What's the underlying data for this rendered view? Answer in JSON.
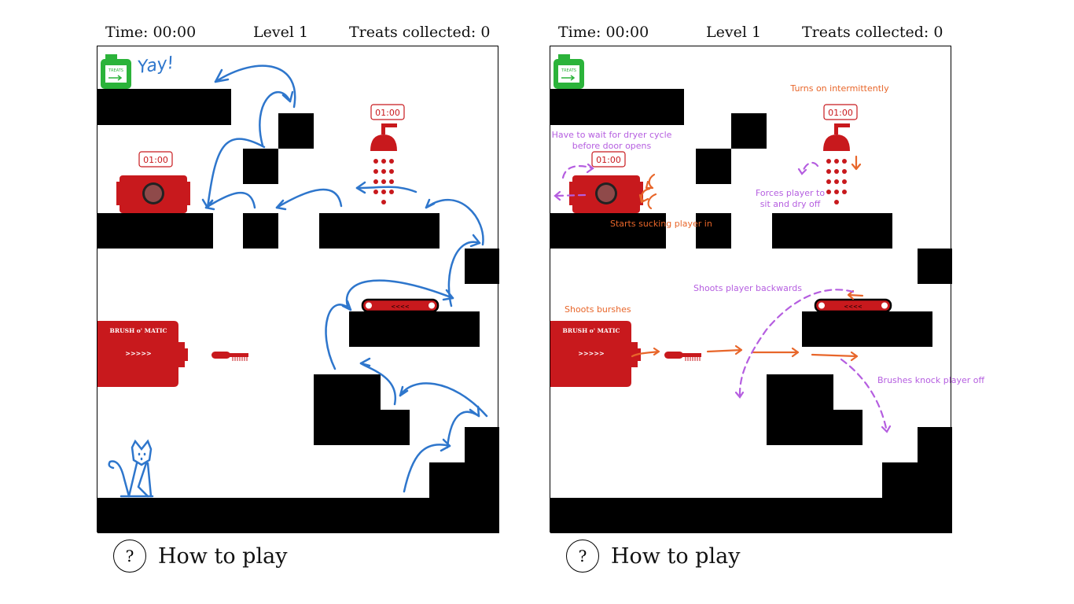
{
  "hud": {
    "time": "Time: 00:00",
    "level": "Level 1",
    "treats": "Treats collected: 0"
  },
  "help": {
    "icon": "?",
    "label": "How to play"
  },
  "sprites": {
    "treat_jar_label": "TREATS",
    "dryer_timer": "01:00",
    "shower_timer": "01:00",
    "brush_machine_name": "BRUSH o' MATIC",
    "brush_machine_arrows": ">>>>>",
    "conveyor_arrows": "<<<<"
  },
  "left_panel": {
    "handwriting": "Yay!"
  },
  "right_panel": {
    "annotations": {
      "turns_on": "Turns on intermittently",
      "wait_dryer_line1": "Have to wait for dryer cycle",
      "wait_dryer_line2": "before door opens",
      "sucking": "Starts sucking player in",
      "forces_line1": "Forces player to",
      "forces_line2": "sit and dry off",
      "shoots_backwards": "Shoots player backwards",
      "shoots_brushes": "Shoots burshes",
      "brushes_knock": "Brushes knock player off"
    }
  },
  "colors": {
    "platform": "#000000",
    "hazard_red": "#c8191d",
    "treat_green": "#2bb33a",
    "path_blue": "#2e76cc",
    "note_orange": "#e8662a",
    "note_purple": "#b55ee0"
  }
}
